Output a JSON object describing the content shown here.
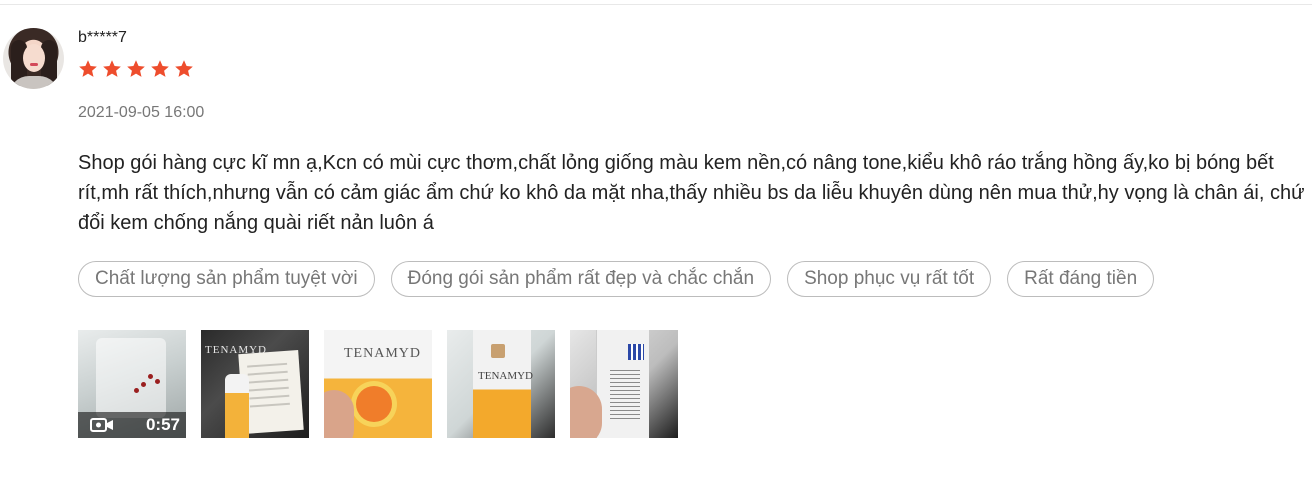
{
  "review": {
    "username": "b*****7",
    "rating": 5,
    "rating_max": 5,
    "star_color": "#ee4d2d",
    "timestamp": "2021-09-05 16:00",
    "comment": "Shop gói hàng cực kĩ mn ạ,Kcn có mùi cực thơm,chất lỏng giống màu kem nền,có nâng tone,kiểu khô ráo trắng hồng ấy,ko bị bóng bết rít,mh rất thích,nhưng vẫn có cảm giác ẩm chứ ko khô da mặt nha,thấy nhiều bs da liễu khuyên dùng nên mua thử,hy vọng là chân ái, chứ đổi kem chống nắng quài riết nản luôn á",
    "tags": [
      "Chất lượng sản phẩm tuyệt vời",
      "Đóng gói sản phẩm rất đẹp và chắc chắn",
      "Shop phục vụ rất tốt",
      "Rất đáng tiền"
    ],
    "media": {
      "video": {
        "duration": "0:57",
        "icon": "video-camera-icon"
      },
      "brand_text": "TENAMYD"
    }
  }
}
